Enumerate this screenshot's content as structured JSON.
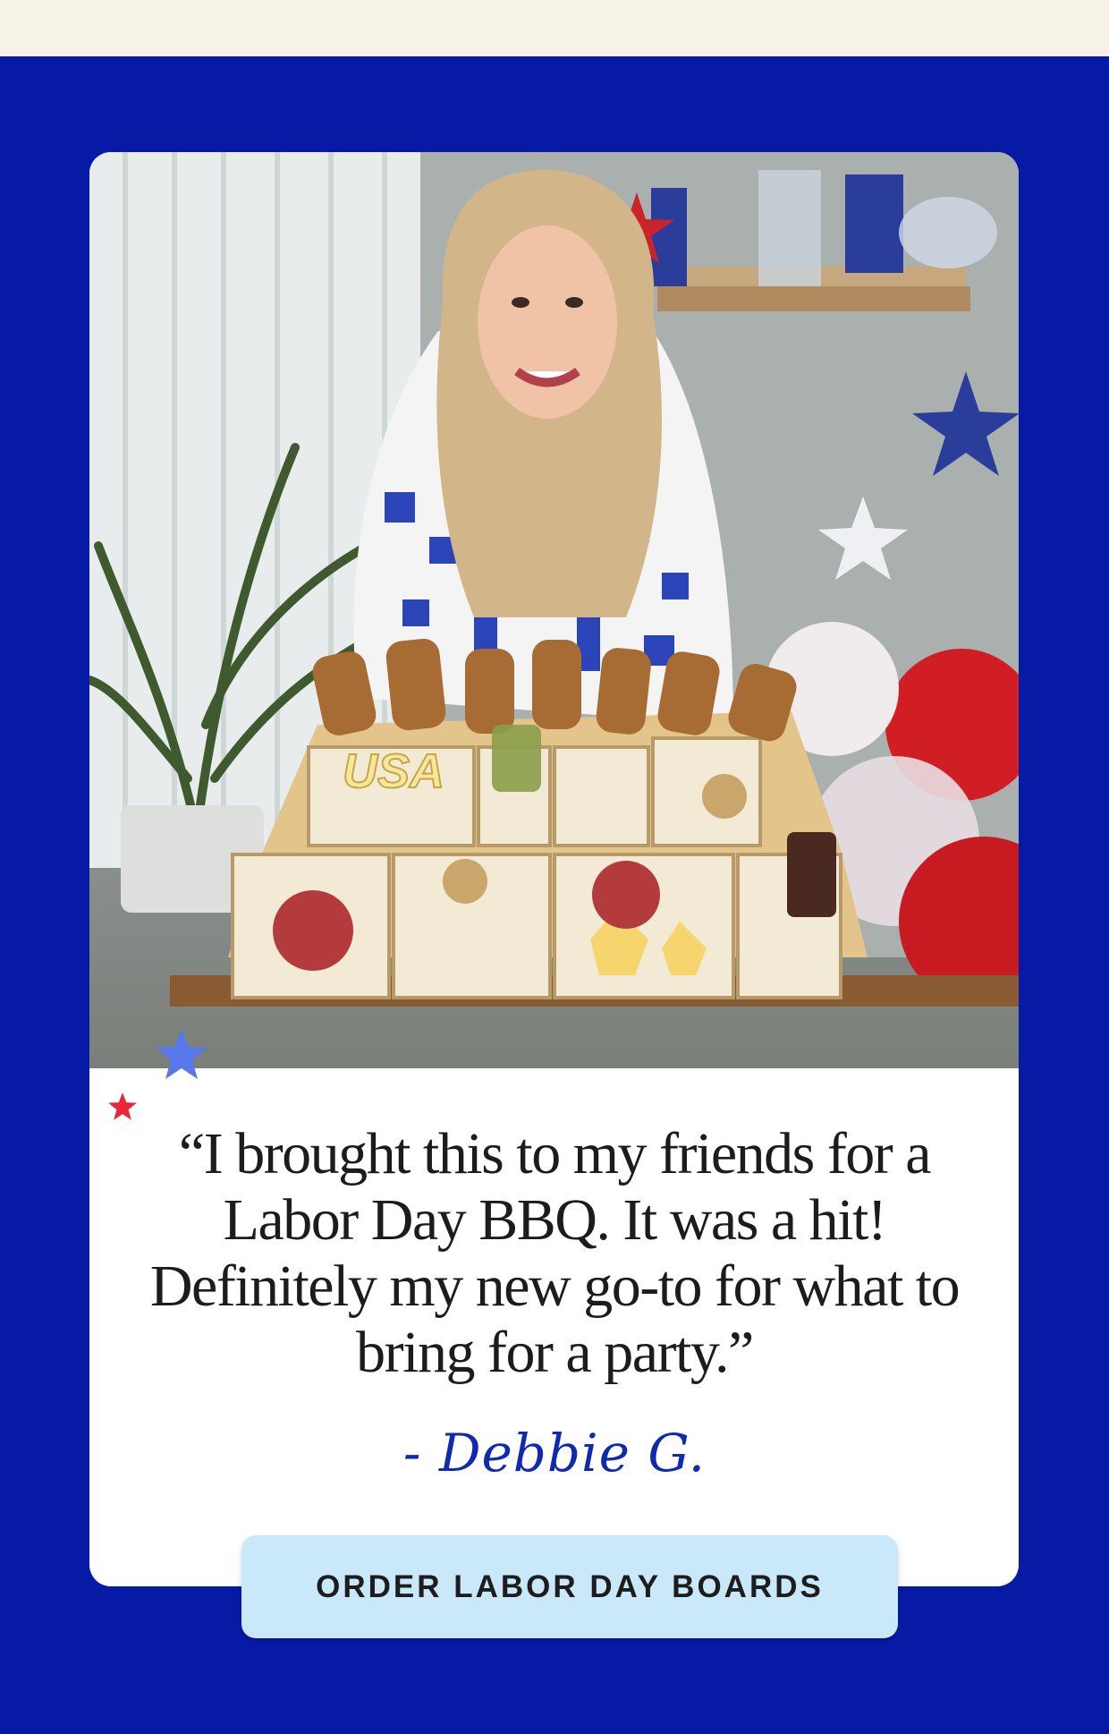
{
  "testimonial": {
    "photo_label": "USA",
    "quote": "“I brought this to my friends for a Labor Day BBQ. It was a hit! Definitely my new go-to for what to bring for a party.”",
    "signature": "- Debbie G."
  },
  "cta": {
    "label": "ORDER LABOR DAY BOARDS"
  },
  "colors": {
    "background": "#071aa6",
    "top_strip": "#f6f2e8",
    "card": "#ffffff",
    "cta_background": "#c9e8fa",
    "signature": "#0f2ab0",
    "star_blue": "#5877e8",
    "star_red": "#e8283a"
  },
  "icons": [
    "star-blue-icon",
    "star-red-icon"
  ]
}
